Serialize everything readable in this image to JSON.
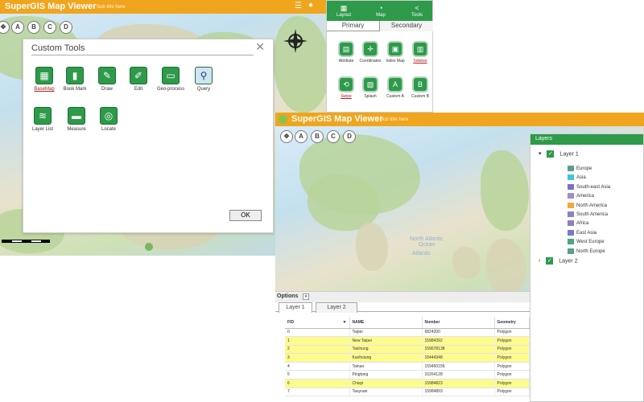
{
  "app": {
    "title": "SuperGIS Map Viewer",
    "subtitle": "Sub title here"
  },
  "map_buttons": [
    "A",
    "B",
    "C",
    "D"
  ],
  "map_labels": {
    "ocean_north_atlantic": "North Atlantic Ocean",
    "ocean_atlantic": "Atlantic"
  },
  "dialog": {
    "title": "Custom Tools",
    "ok": "OK",
    "tools": [
      {
        "label": "BaseMap",
        "icon": "grid-icon"
      },
      {
        "label": "Book Mark",
        "icon": "bookmark-icon"
      },
      {
        "label": "Draw",
        "icon": "pencil-icon"
      },
      {
        "label": "Edit",
        "icon": "edit-icon"
      },
      {
        "label": "Geo-process",
        "icon": "toolbox-icon"
      },
      {
        "label": "Query",
        "icon": "magnifier-icon"
      },
      {
        "label": "Layer List",
        "icon": "layers-icon"
      },
      {
        "label": "Measure",
        "icon": "ruler-icon"
      },
      {
        "label": "Locate",
        "icon": "target-icon"
      }
    ]
  },
  "panel1": {
    "top_buttons": [
      {
        "label": "Layout",
        "icon": "layout-icon"
      },
      {
        "label": "Map",
        "icon": "map-icon"
      },
      {
        "label": "Tools",
        "icon": "share-icon"
      }
    ],
    "tabs": [
      "Primary",
      "Secondary"
    ],
    "buttons": [
      {
        "label": "Attribute",
        "icon": "table-icon"
      },
      {
        "label": "Coordinates",
        "icon": "crosshair-icon"
      },
      {
        "label": "Index Map",
        "icon": "index-map-icon"
      },
      {
        "label": "Sidebar",
        "icon": "sidebar-icon"
      },
      {
        "label": "Swipe",
        "icon": "swipe-icon"
      },
      {
        "label": "Splash",
        "icon": "splash-icon"
      },
      {
        "label": "Custom A",
        "icon": "custom-a-icon"
      },
      {
        "label": "Custom B",
        "icon": "custom-b-icon"
      }
    ]
  },
  "layers_panel": {
    "title": "Layers",
    "layer1": "Layer 1",
    "layer2": "Layer 2",
    "legend": [
      {
        "name": "Europe",
        "color": "#5c9e8c"
      },
      {
        "name": "Asia",
        "color": "#3fc6d8"
      },
      {
        "name": "South-east Asia",
        "color": "#7a73c0"
      },
      {
        "name": "America",
        "color": "#a28cc9"
      },
      {
        "name": "North America",
        "color": "#f2a93b"
      },
      {
        "name": "South America",
        "color": "#8a84c4"
      },
      {
        "name": "Africa",
        "color": "#8f7fbf"
      },
      {
        "name": "East Asia",
        "color": "#7a78c6"
      },
      {
        "name": "West Europe",
        "color": "#4aa77f"
      },
      {
        "name": "North Europe",
        "color": "#5c9e8c"
      }
    ]
  },
  "attribute": {
    "options": "Options",
    "tabs": [
      "Layer 1",
      "Layer 2"
    ],
    "columns": [
      "FID",
      "NAME",
      "Number",
      "Geometry"
    ],
    "rows": [
      {
        "fid": "0",
        "name": "Taipei",
        "number": "6824200",
        "geo": "Polygon",
        "hl": false
      },
      {
        "fid": "1",
        "name": "New Taipei",
        "number": "15984392",
        "geo": "Polygon",
        "hl": true
      },
      {
        "fid": "2",
        "name": "Taichung",
        "number": "159678138",
        "geo": "Polygon",
        "hl": true
      },
      {
        "fid": "3",
        "name": "Kaohsiung",
        "number": "15444348",
        "geo": "Polygon",
        "hl": true
      },
      {
        "fid": "4",
        "name": "Tainan",
        "number": "159450156",
        "geo": "Polygon",
        "hl": false
      },
      {
        "fid": "5",
        "name": "Pingtung",
        "number": "15264128",
        "geo": "Polygon",
        "hl": false
      },
      {
        "fid": "6",
        "name": "Chiayi",
        "number": "15984823",
        "geo": "Polygon",
        "hl": true
      },
      {
        "fid": "7",
        "name": "Taoyuan",
        "number": "15984893",
        "geo": "Polygon",
        "hl": false
      }
    ]
  }
}
